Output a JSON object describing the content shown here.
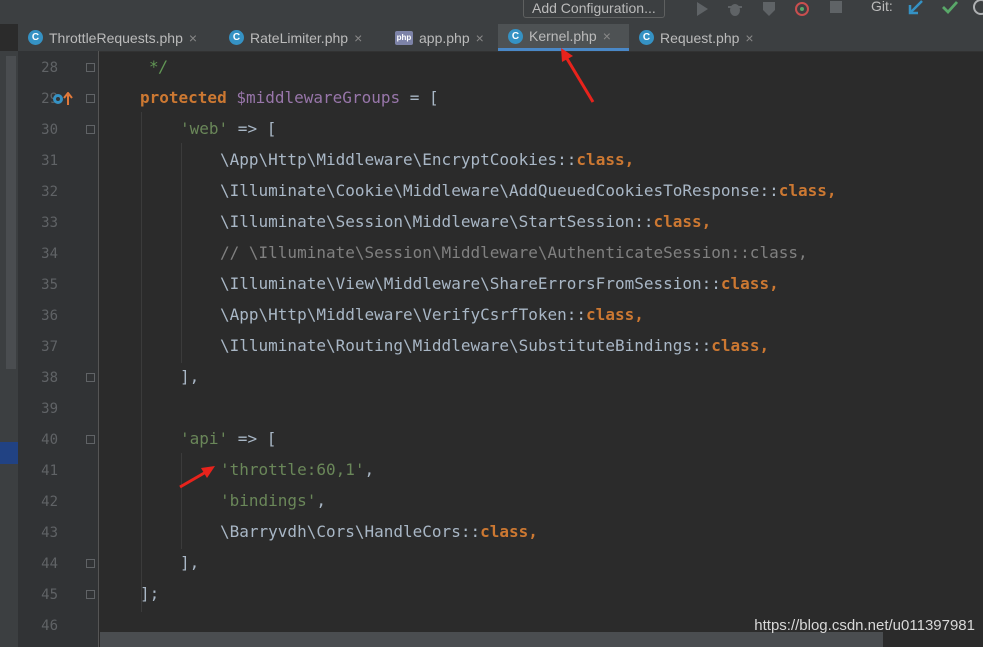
{
  "toolbar": {
    "add_configuration_label": "Add Configuration...",
    "git_label": "Git:",
    "icons": [
      "run-icon",
      "debug-icon",
      "coverage-icon",
      "profile-icon",
      "stop-icon",
      "git-update-icon",
      "git-commit-icon",
      "history-icon"
    ]
  },
  "tabs": [
    {
      "label": "ThrottleRequests.php",
      "icon": "C",
      "active": false
    },
    {
      "label": "RateLimiter.php",
      "icon": "C",
      "active": false
    },
    {
      "label": "app.php",
      "icon": "php",
      "active": false
    },
    {
      "label": "Kernel.php",
      "icon": "C",
      "active": true
    },
    {
      "label": "Request.php",
      "icon": "C",
      "active": false
    }
  ],
  "tab_close_glyph": "×",
  "line_numbers": [
    "28",
    "29",
    "30",
    "31",
    "32",
    "33",
    "34",
    "35",
    "36",
    "37",
    "38",
    "39",
    "40",
    "41",
    "42",
    "43",
    "44",
    "45",
    "46"
  ],
  "code_lines": [
    [
      {
        "t": "*/",
        "s": "dcmt"
      }
    ],
    [
      {
        "t": "protected",
        "s": "kw"
      },
      {
        "t": " ",
        "s": ""
      },
      {
        "t": "$middlewareGroups",
        "s": "var"
      },
      {
        "t": " = [",
        "s": ""
      }
    ],
    [
      {
        "t": "'web'",
        "s": "str"
      },
      {
        "t": " => [",
        "s": ""
      }
    ],
    [
      {
        "t": "\\App\\Http\\Middleware\\EncryptCookies::",
        "s": ""
      },
      {
        "t": "class",
        "s": "kw"
      },
      {
        "t": ",",
        "s": "kw"
      }
    ],
    [
      {
        "t": "\\Illuminate\\Cookie\\Middleware\\AddQueuedCookiesToResponse::",
        "s": ""
      },
      {
        "t": "class",
        "s": "kw"
      },
      {
        "t": ",",
        "s": "kw"
      }
    ],
    [
      {
        "t": "\\Illuminate\\Session\\Middleware\\StartSession::",
        "s": ""
      },
      {
        "t": "class",
        "s": "kw"
      },
      {
        "t": ",",
        "s": "kw"
      }
    ],
    [
      {
        "t": "// \\Illuminate\\Session\\Middleware\\AuthenticateSession::class,",
        "s": "cmt"
      }
    ],
    [
      {
        "t": "\\Illuminate\\View\\Middleware\\ShareErrorsFromSession::",
        "s": ""
      },
      {
        "t": "class",
        "s": "kw"
      },
      {
        "t": ",",
        "s": "kw"
      }
    ],
    [
      {
        "t": "\\App\\Http\\Middleware\\VerifyCsrfToken::",
        "s": ""
      },
      {
        "t": "class",
        "s": "kw"
      },
      {
        "t": ",",
        "s": "kw"
      }
    ],
    [
      {
        "t": "\\Illuminate\\Routing\\Middleware\\SubstituteBindings::",
        "s": ""
      },
      {
        "t": "class",
        "s": "kw"
      },
      {
        "t": ",",
        "s": "kw"
      }
    ],
    [
      {
        "t": "],",
        "s": ""
      }
    ],
    [],
    [
      {
        "t": "'api'",
        "s": "str"
      },
      {
        "t": " => [",
        "s": ""
      }
    ],
    [
      {
        "t": "'throttle:60,1'",
        "s": "str"
      },
      {
        "t": ",",
        "s": ""
      }
    ],
    [
      {
        "t": "'bindings'",
        "s": "str"
      },
      {
        "t": ",",
        "s": ""
      }
    ],
    [
      {
        "t": "\\Barryvdh\\Cors\\HandleCors::",
        "s": ""
      },
      {
        "t": "class",
        "s": "kw"
      },
      {
        "t": ",",
        "s": "kw"
      }
    ],
    [
      {
        "t": "],",
        "s": ""
      }
    ],
    [
      {
        "t": "];",
        "s": ""
      }
    ],
    []
  ],
  "watermark": "https://blog.csdn.net/u011397981",
  "colors": {
    "annotation_arrow": "#e8231c",
    "active_tab_underline": "#4a88c7"
  }
}
